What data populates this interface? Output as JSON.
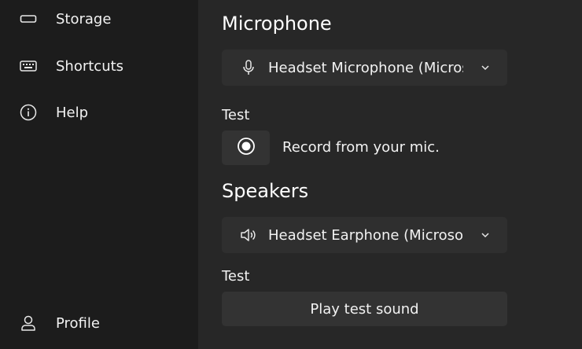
{
  "sidebar": {
    "items": [
      {
        "label": "Storage",
        "icon": "storage-icon"
      },
      {
        "label": "Shortcuts",
        "icon": "keyboard-icon"
      },
      {
        "label": "Help",
        "icon": "info-icon"
      }
    ],
    "profile": {
      "label": "Profile",
      "icon": "person-icon"
    }
  },
  "microphone": {
    "title": "Microphone",
    "device": "Headset Microphone (Microsoft)",
    "test_label": "Test",
    "record_text": "Record from your mic."
  },
  "speakers": {
    "title": "Speakers",
    "device": "Headset Earphone (Microsoft)",
    "test_label": "Test",
    "play_label": "Play test sound"
  },
  "colors": {
    "sidebar_bg": "#1c1c1c",
    "main_bg": "#272727",
    "control_bg": "#2f2f2f",
    "text": "#f2f2f2"
  }
}
